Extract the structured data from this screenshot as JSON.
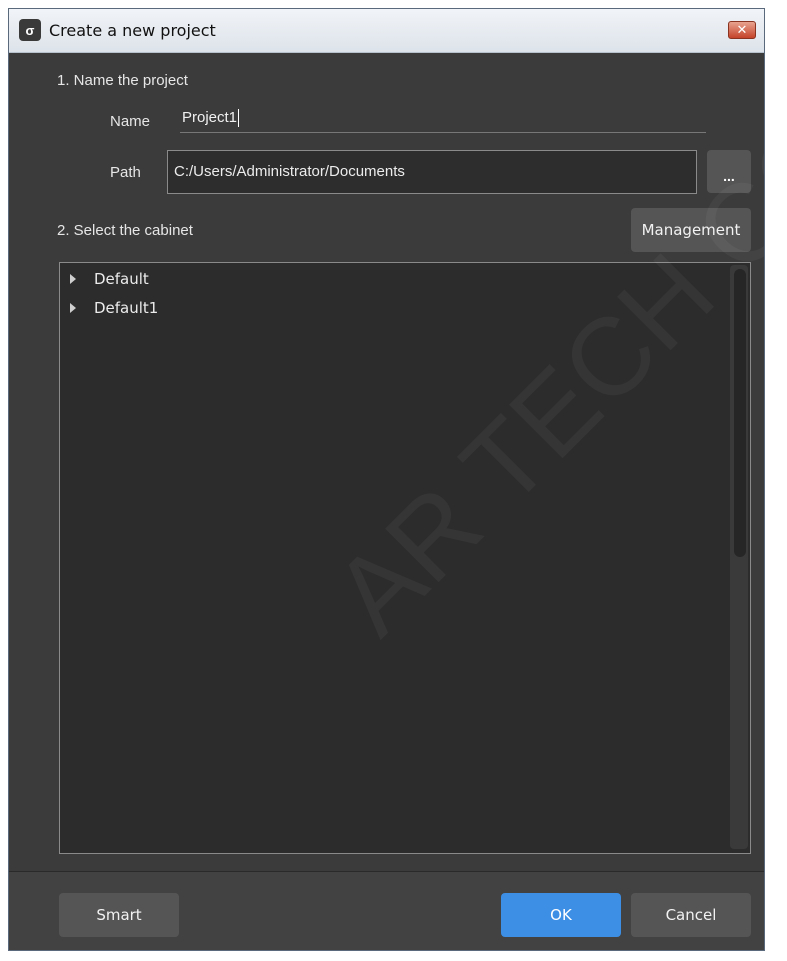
{
  "window": {
    "title": "Create a new project",
    "app_icon_glyph": "σ",
    "close_glyph": "✕"
  },
  "section1": {
    "heading": "1. Name the project",
    "name_label": "Name",
    "name_value": "Project1",
    "path_label": "Path",
    "path_value": "C:/Users/Administrator/Documents",
    "browse_label": "..."
  },
  "section2": {
    "heading": "2. Select the cabinet",
    "management_label": "Management",
    "cabinets": [
      {
        "label": "Default"
      },
      {
        "label": "Default1"
      }
    ]
  },
  "footer": {
    "smart_label": "Smart",
    "ok_label": "OK",
    "cancel_label": "Cancel"
  },
  "colors": {
    "background": "#3b3b3b",
    "ok_button": "#3d8fe6",
    "secondary_button": "#555555"
  },
  "watermark": "AR TECH CO"
}
